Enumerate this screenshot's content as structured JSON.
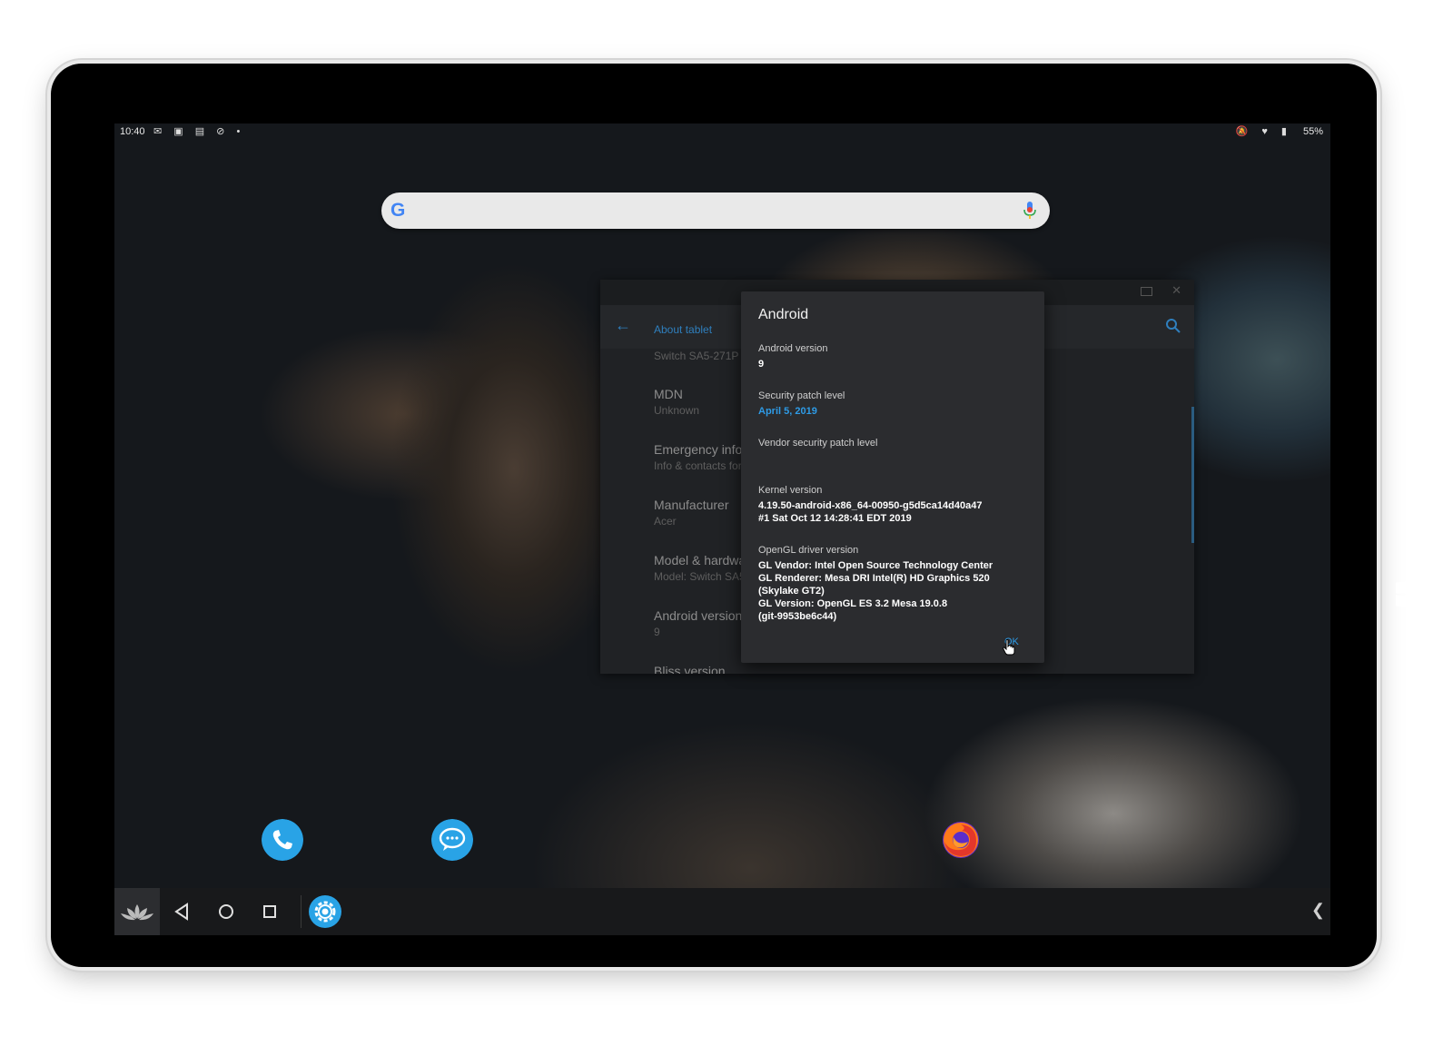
{
  "status_bar": {
    "time": "10:40",
    "left_icons": "✉ ▣ ▤ ⊘ •",
    "right_icons": "🔕 ♥ ▮",
    "battery": "55%"
  },
  "search_bar": {
    "logo": "G"
  },
  "settings_window": {
    "title": "About tablet",
    "items": [
      {
        "title": "",
        "subtitle": "Switch SA5-271P"
      },
      {
        "title": "MDN",
        "subtitle": "Unknown"
      },
      {
        "title": "Emergency inform",
        "subtitle": "Info & contacts for"
      },
      {
        "title": "Manufacturer",
        "subtitle": "Acer"
      },
      {
        "title": "Model & hardwar",
        "subtitle": "Model: Switch SA5-"
      },
      {
        "title": "Android version",
        "subtitle": "9"
      },
      {
        "title": "Bliss version",
        "subtitle": ""
      }
    ]
  },
  "dialog": {
    "title": "Android",
    "fields": [
      {
        "label": "Android version",
        "value": "9"
      },
      {
        "label": "Security patch level",
        "value": "April 5, 2019"
      },
      {
        "label": "Vendor security patch level",
        "value": ""
      },
      {
        "label": "Kernel version",
        "value": "4.19.50-android-x86_64-00950-g5d5ca14d40a47\n#1 Sat Oct 12 14:28:41 EDT 2019"
      },
      {
        "label": "OpenGL driver version",
        "value": "GL Vendor: Intel Open Source Technology Center\nGL Renderer: Mesa DRI Intel(R) HD Graphics 520\n(Skylake GT2)\nGL Version: OpenGL ES 3.2 Mesa 19.0.8\n(git-9953be6c44)"
      }
    ],
    "ok_label": "OK"
  },
  "taskbar": {
    "chevron": "❮"
  },
  "colors": {
    "accent": "#2e9be6",
    "phone_app": "#29a3e6",
    "messages_app": "#29a3e6",
    "settings_app": "#29a3e6"
  }
}
